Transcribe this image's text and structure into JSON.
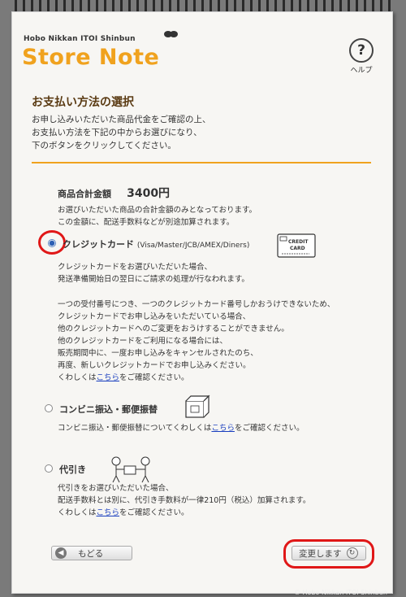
{
  "header": {
    "brand_small": "Hobo Nikkan ITOI Shinbun",
    "brand_big": "Store Note",
    "help_symbol": "?",
    "help_label": "ヘルプ"
  },
  "section": {
    "title": "お支払い方法の選択",
    "intro": [
      "お申し込みいただいた商品代金をご確認の上、",
      "お支払い方法を下記の中からお選びになり、",
      "下のボタンをクリックしてください。"
    ]
  },
  "summary": {
    "total_label": "商品合計金額",
    "total_value": "3400円",
    "notes": [
      "お選びいただいた商品の合計金額のみとなっております。",
      "この金額に、配送手数料などが別途加算されます。"
    ]
  },
  "options": {
    "credit": {
      "label": "クレジットカード",
      "sub": "(Visa/Master/JCB/AMEX/Diners)",
      "selected": true,
      "icon": "credit-card-icon",
      "icon_text_1": "CREDIT",
      "icon_text_2": "CARD",
      "desc1": [
        "クレジットカードをお選びいただいた場合、",
        "発送準備開始日の翌日にご請求の処理が行なわれます。"
      ],
      "desc2": [
        "一つの受付番号につき、一つのクレジットカード番号しかおうけできないため、",
        "クレジットカードでお申し込みをいただいている場合、",
        "他のクレジットカードへのご変更をおうけすることができません。",
        "他のクレジットカードをご利用になる場合には、",
        "販売期間中に、一度お申し込みをキャンセルされたのち、",
        "再度、新しいクレジットカードでお申し込みください。"
      ],
      "detail_prefix": "くわしくは",
      "detail_link": "こちら",
      "detail_suffix": "をご確認ください。"
    },
    "convenience": {
      "label": "コンビニ振込・郵便振替",
      "selected": false,
      "icon": "convenience-store-icon",
      "desc_prefix": "コンビニ振込・郵便振替についてくわしくは",
      "desc_link": "こちら",
      "desc_suffix": "をご確認ください。"
    },
    "cod": {
      "label": "代引き",
      "selected": false,
      "icon": "cash-on-delivery-icon",
      "desc": [
        "代引きをお選びいただいた場合、",
        "配送手数料とは別に、代引き手数料が一律210円（税込）加算されます。"
      ],
      "detail_prefix": "くわしくは",
      "detail_link": "こちら",
      "detail_suffix": "をご確認ください。"
    }
  },
  "buttons": {
    "back_label": "もどる",
    "next_label": "変更します"
  },
  "footer": {
    "copyright": "© Hobo Nikkan ITOI Shinbun"
  },
  "colors": {
    "accent": "#f0a21e",
    "heading": "#5a3a12",
    "highlight": "#e01717",
    "link": "#1a3fbf"
  }
}
